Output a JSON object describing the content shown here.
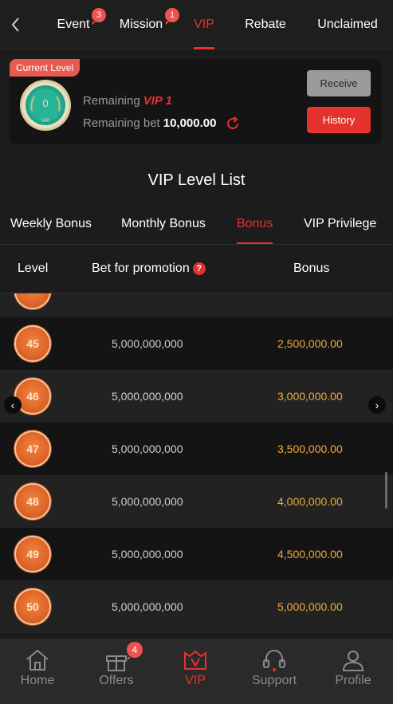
{
  "topnav": {
    "tabs": [
      {
        "label": "Event",
        "badge": "3"
      },
      {
        "label": "Mission",
        "badge": "1"
      },
      {
        "label": "VIP",
        "badge": null
      },
      {
        "label": "Rebate",
        "badge": null
      },
      {
        "label": "Unclaimed",
        "badge": null
      }
    ],
    "active": "VIP"
  },
  "current": {
    "tag": "Current Level",
    "level": "0",
    "medal_text": "VIP",
    "remaining_label": "Remaining",
    "remaining_vip": "VIP 1",
    "remaining_bet_label": "Remaining bet",
    "remaining_bet": "10,000.00",
    "receive_label": "Receive",
    "history_label": "History"
  },
  "list_title": "VIP Level List",
  "bonus_tabs": {
    "tabs": [
      "Weekly Bonus",
      "Monthly Bonus",
      "Bonus",
      "VIP Privilege"
    ],
    "active": "Bonus"
  },
  "table": {
    "headers": {
      "level": "Level",
      "bet": "Bet for promotion",
      "bonus": "Bonus"
    },
    "help_mark": "?",
    "rows": [
      {
        "level": "45",
        "bet": "5,000,000,000",
        "bonus": "2,500,000.00"
      },
      {
        "level": "46",
        "bet": "5,000,000,000",
        "bonus": "3,000,000.00"
      },
      {
        "level": "47",
        "bet": "5,000,000,000",
        "bonus": "3,500,000.00"
      },
      {
        "level": "48",
        "bet": "5,000,000,000",
        "bonus": "4,000,000.00"
      },
      {
        "level": "49",
        "bet": "5,000,000,000",
        "bonus": "4,500,000.00"
      },
      {
        "level": "50",
        "bet": "5,000,000,000",
        "bonus": "5,000,000.00"
      }
    ]
  },
  "bottomnav": {
    "items": [
      {
        "label": "Home",
        "icon": "home-icon"
      },
      {
        "label": "Offers",
        "icon": "gift-icon",
        "badge": "4"
      },
      {
        "label": "VIP",
        "icon": "crown-icon"
      },
      {
        "label": "Support",
        "icon": "headset-icon"
      },
      {
        "label": "Profile",
        "icon": "user-icon"
      }
    ],
    "active": "VIP"
  },
  "colors": {
    "accent": "#e5322d",
    "bonus_text": "#f2a93b",
    "background": "#1c1c1c",
    "medal": "#1fa28a"
  }
}
